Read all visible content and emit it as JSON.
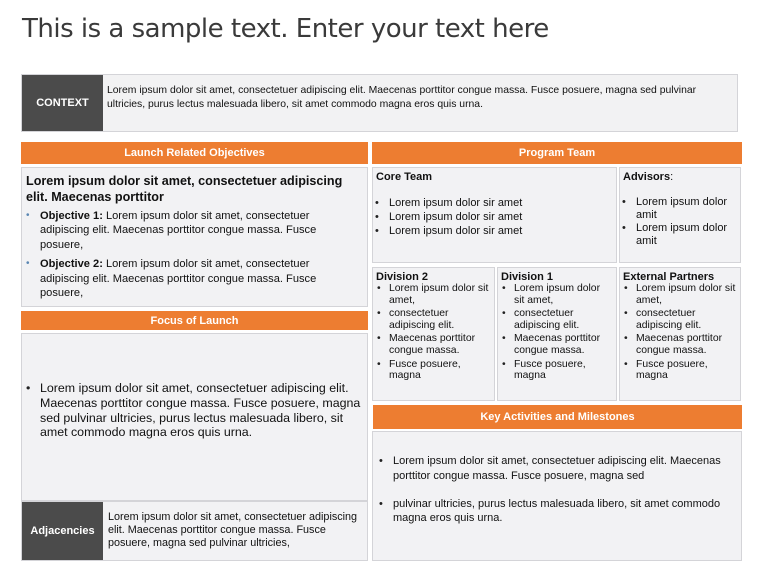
{
  "title": "This is a sample text. Enter your text here",
  "context": {
    "label": "CONTEXT",
    "text": "Lorem ipsum dolor sit amet, consectetuer adipiscing elit. Maecenas porttitor congue massa. Fusce posuere, magna sed pulvinar ultricies, purus lectus malesuada libero, sit amet commodo magna eros quis urna."
  },
  "objectives": {
    "header": "Launch Related Objectives",
    "heading": "Lorem ipsum dolor sit amet, consectetuer adipiscing elit. Maecenas porttitor",
    "items": [
      {
        "label": "Objective 1:",
        "text": " Lorem ipsum dolor sit amet, consectetuer adipiscing elit. Maecenas porttitor congue massa. Fusce posuere,"
      },
      {
        "label": "Objective 2:",
        "text": " Lorem ipsum dolor sit amet, consectetuer adipiscing elit. Maecenas porttitor congue massa. Fusce posuere,"
      }
    ]
  },
  "focus": {
    "header": "Focus of Launch",
    "items": [
      "Lorem ipsum dolor sit amet, consectetuer adipiscing elit. Maecenas porttitor congue massa. Fusce posuere, magna sed pulvinar ultricies, purus lectus malesuada libero, sit amet commodo magna eros quis urna."
    ]
  },
  "adjacencies": {
    "label": "Adjacencies",
    "text": "Lorem ipsum dolor sit amet, consectetuer adipiscing elit. Maecenas porttitor congue massa. Fusce posuere, magna sed pulvinar ultricies,"
  },
  "program_team": {
    "header": "Program Team",
    "core_team": {
      "title": "Core Team",
      "items": [
        "Lorem ipsum dolor sir amet",
        "Lorem ipsum dolor sir amet",
        "Lorem ipsum dolor sir amet"
      ]
    },
    "advisors": {
      "title": "Advisors",
      "suffix": ":",
      "items": [
        "Lorem ipsum dolor amit",
        "Lorem ipsum dolor amit"
      ]
    },
    "division2": {
      "title": "Division 2",
      "items": [
        "Lorem ipsum dolor sit amet,",
        "consectetuer adipiscing elit.",
        "Maecenas porttitor congue massa.",
        "Fusce posuere, magna"
      ]
    },
    "division1": {
      "title": "Division 1",
      "items": [
        "Lorem ipsum dolor sit amet,",
        "consectetuer adipiscing elit.",
        "Maecenas porttitor congue massa.",
        "Fusce posuere, magna"
      ]
    },
    "external_partners": {
      "title": "External Partners",
      "items": [
        "Lorem ipsum dolor sit amet,",
        "consectetuer adipiscing elit.",
        "Maecenas porttitor congue massa.",
        "Fusce posuere, magna"
      ]
    }
  },
  "key_activities": {
    "header": "Key Activities and Milestones",
    "items": [
      "Lorem ipsum dolor sit amet, consectetuer adipiscing elit. Maecenas porttitor congue massa. Fusce posuere, magna sed",
      "pulvinar ultricies, purus lectus malesuada libero, sit amet commodo magna eros quis urna."
    ]
  },
  "colors": {
    "accent_orange": "#ED7D31",
    "label_dark": "#4B4B4B",
    "panel_bg": "#F2F2F4"
  }
}
